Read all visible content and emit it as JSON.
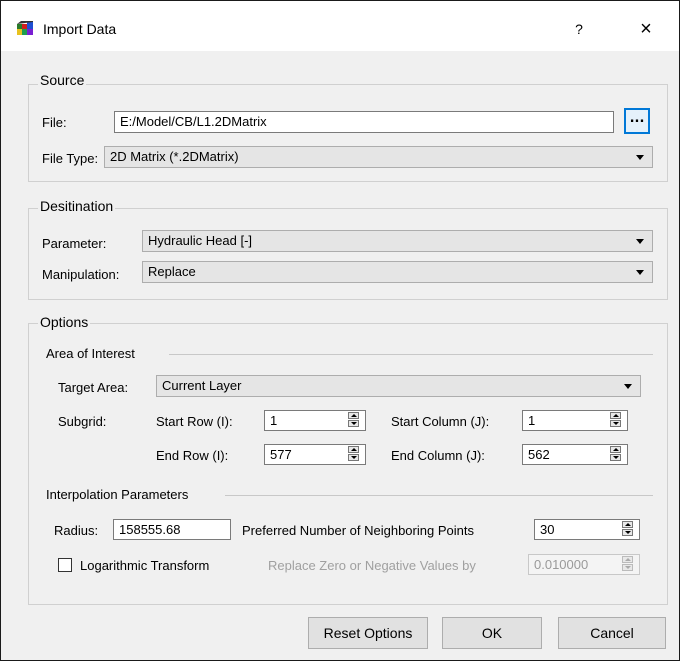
{
  "window": {
    "title": "Import Data",
    "help_label": "?",
    "close_label": "×"
  },
  "source": {
    "group_title": "Source",
    "file_label": "File:",
    "file_value": "E:/Model/CB/L1.2DMatrix",
    "browse_label": "...",
    "file_type_label": "File Type:",
    "file_type_value": "2D Matrix (*.2DMatrix)"
  },
  "destination": {
    "group_title": "Desitination",
    "parameter_label": "Parameter:",
    "parameter_value": "Hydraulic Head [-]",
    "manipulation_label": "Manipulation:",
    "manipulation_value": "Replace"
  },
  "options": {
    "group_title": "Options",
    "area_of_interest": {
      "title": "Area of Interest",
      "target_area_label": "Target Area:",
      "target_area_value": "Current Layer",
      "subgrid_label": "Subgrid:",
      "start_row_label": "Start Row (I):",
      "start_row_value": "1",
      "start_col_label": "Start Column (J):",
      "start_col_value": "1",
      "end_row_label": "End Row (I):",
      "end_row_value": "577",
      "end_col_label": "End Column (J):",
      "end_col_value": "562"
    },
    "interpolation": {
      "title": "Interpolation Parameters",
      "radius_label": "Radius:",
      "radius_value": "158555.68",
      "neighbors_label": "Preferred Number of Neighboring Points",
      "neighbors_value": "30",
      "log_transform_label": "Logarithmic Transform",
      "log_transform_checked": false,
      "replace_zero_label": "Replace Zero or Negative Values by",
      "replace_zero_value": "0.010000"
    }
  },
  "buttons": {
    "reset": "Reset Options",
    "ok": "OK",
    "cancel": "Cancel"
  },
  "colors": {
    "accent": "#0078d7",
    "window_bg": "#f0f0f0"
  }
}
